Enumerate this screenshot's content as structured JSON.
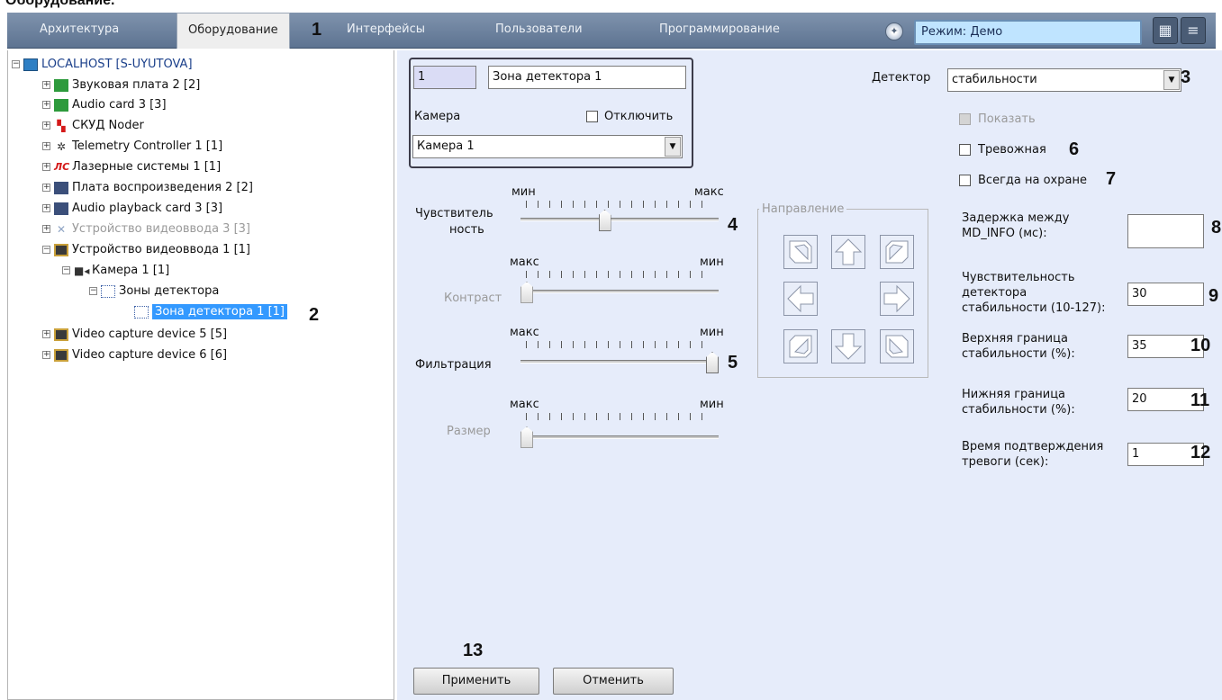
{
  "doc_heading": "Оборудование.",
  "topbar": {
    "tabs": [
      "Архитектура",
      "Оборудование",
      "Интерфейсы",
      "Пользователи",
      "Программирование"
    ],
    "mode": "Режим: Демо"
  },
  "callouts": [
    "1",
    "2",
    "3",
    "4",
    "5",
    "6",
    "7",
    "8",
    "9",
    "10",
    "11",
    "12",
    "13"
  ],
  "tree": [
    {
      "label": "LOCALHOST [S-UYUTOVA]",
      "icon": "computer-icon"
    },
    {
      "label": "Звуковая плата 2 [2]",
      "icon": "sound-card-icon"
    },
    {
      "label": "Audio card 3 [3]",
      "icon": "sound-card-icon"
    },
    {
      "label": "СКУД Noder",
      "icon": "access-control-icon"
    },
    {
      "label": "Telemetry Controller 1 [1]",
      "icon": "telemetry-icon"
    },
    {
      "label": "Лазерные системы 1 [1]",
      "icon": "laser-systems-icon",
      "icon_text": "ЛС"
    },
    {
      "label": "Плата воспроизведения 2 [2]",
      "icon": "playback-card-icon"
    },
    {
      "label": "Audio playback card 3 [3]",
      "icon": "playback-card-icon"
    },
    {
      "label": "Устройство видеоввода 3 [3]",
      "icon": "disabled-x-icon"
    },
    {
      "label": "Устройство видеоввода 1 [1]",
      "icon": "video-capture-icon"
    },
    {
      "label": "Камера 1 [1]",
      "icon": "camera-icon"
    },
    {
      "label": "Зоны детектора",
      "icon": "detector-zones-icon"
    },
    {
      "label": "Зона детектора 1 [1]",
      "icon": "detector-zone-icon"
    },
    {
      "label": "Video capture device 5 [5]",
      "icon": "video-capture-icon"
    },
    {
      "label": "Video capture device 6 [6]",
      "icon": "video-capture-icon"
    }
  ],
  "zone": {
    "id": "1",
    "name": "Зона детектора 1",
    "camera_label": "Камера",
    "disable_label": "Отключить",
    "camera_value": "Камера 1"
  },
  "detector": {
    "label": "Детектор",
    "value": "стабильности",
    "show_label": "Показать",
    "alarm_label": "Тревожная",
    "always_armed_label": "Всегда на охране"
  },
  "sliders": {
    "sensitivity": {
      "label_line1": "Чувствитель",
      "label_line2": "ность",
      "left": "мин",
      "right": "макс",
      "value": 0.42
    },
    "contrast": {
      "label": "Контраст",
      "left": "макс",
      "right": "мин",
      "value": 0.0
    },
    "filtering": {
      "label": "Фильтрация",
      "left": "макс",
      "right": "мин",
      "value": 1.0
    },
    "size": {
      "label": "Размер",
      "left": "макс",
      "right": "мин",
      "value": 0.0
    }
  },
  "direction": {
    "legend": "Направление"
  },
  "params": [
    {
      "label_lines": [
        "Задержка между",
        "MD_INFO (мс):"
      ],
      "value": ""
    },
    {
      "label_lines": [
        "Чувствительность",
        "детектора",
        "стабильности (10-127):"
      ],
      "value": "30"
    },
    {
      "label_lines": [
        "Верхняя граница",
        "стабильности (%):"
      ],
      "value": "35"
    },
    {
      "label_lines": [
        "Нижняя граница",
        "стабильности (%):"
      ],
      "value": "20"
    },
    {
      "label_lines": [
        "Время подтверждения",
        "тревоги (сек):"
      ],
      "value": "1"
    }
  ],
  "buttons": {
    "apply": "Применить",
    "cancel": "Отменить"
  }
}
